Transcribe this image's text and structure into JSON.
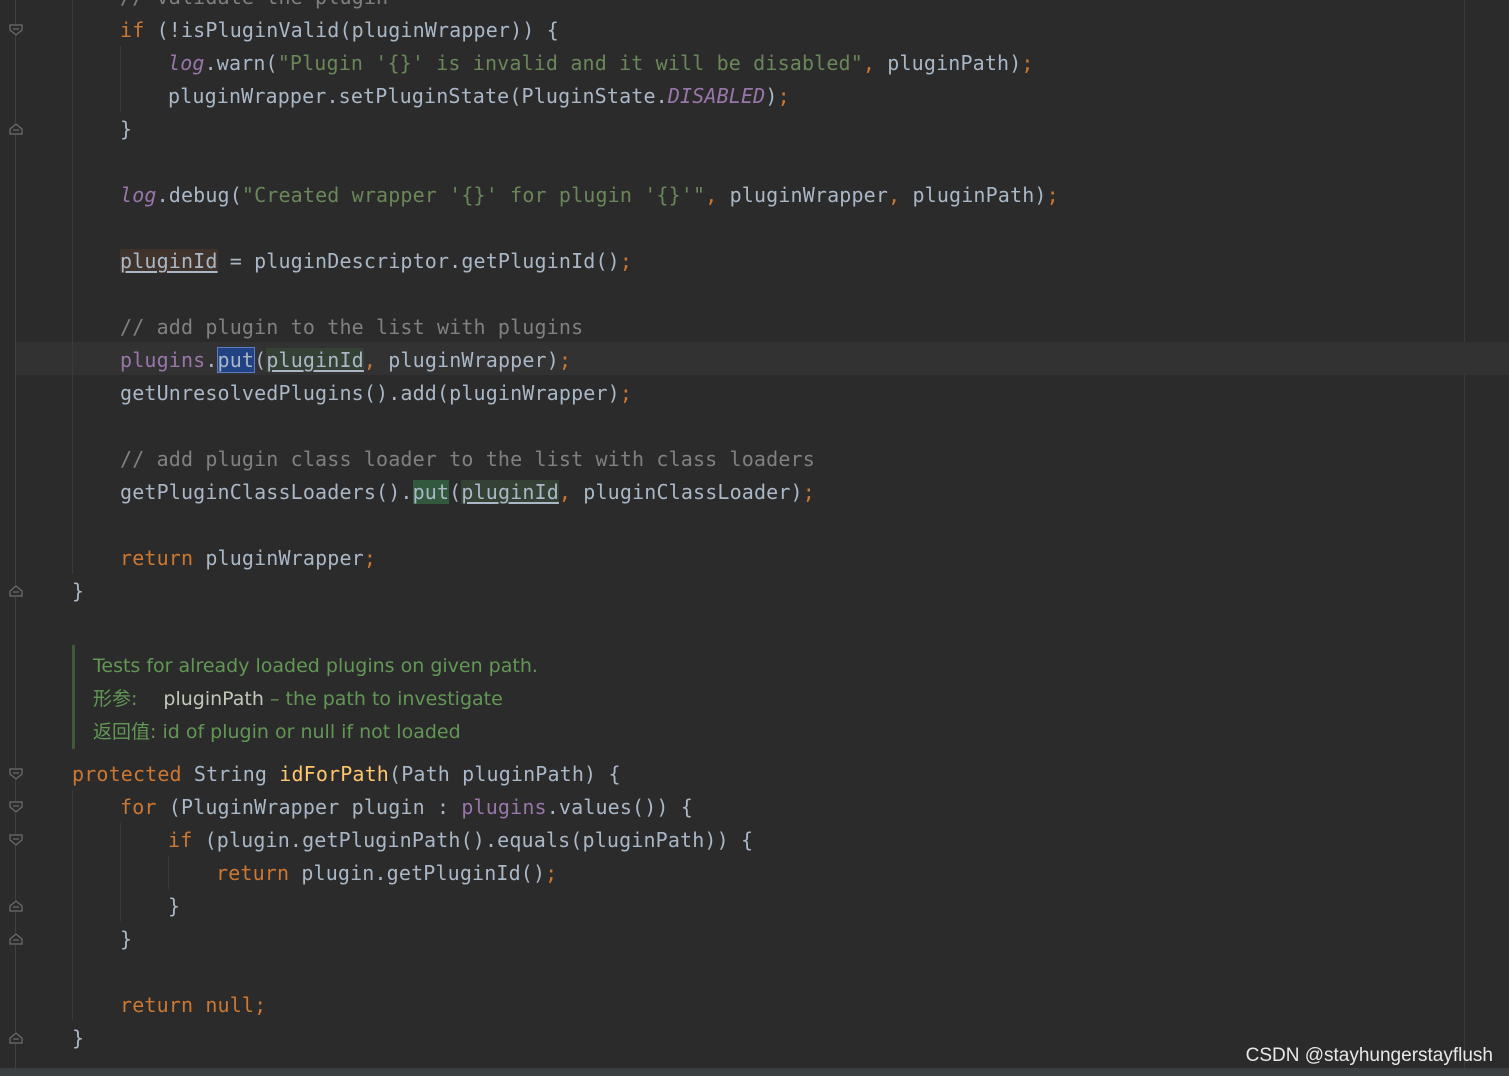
{
  "code": {
    "line_top": "// validate the plugin",
    "if_valid": {
      "kw": "if",
      "rest": " (!isPluginValid(pluginWrapper)) {"
    },
    "warn": {
      "obj": "log",
      "call": ".warn(",
      "str": "\"Plugin '{}' is invalid and it will be disabled\"",
      "comma": ",",
      "args": " pluginPath)",
      "semi": ";"
    },
    "set_state": {
      "pre": "pluginWrapper.setPluginState(PluginState.",
      "const": "DISABLED",
      "post": ")",
      "semi": ";"
    },
    "brace_close": "}",
    "debug": {
      "obj": "log",
      "call": ".debug(",
      "str": "\"Created wrapper '{}' for plugin '{}'\"",
      "c1": ",",
      "a1": " pluginWrapper",
      "c2": ",",
      "a2": " pluginPath)",
      "semi": ";"
    },
    "assign": {
      "var": "pluginId",
      "rest": " = pluginDescriptor.getPluginId()",
      "semi": ";"
    },
    "comment_add": "// add plugin to the list with plugins",
    "put": {
      "obj": "plugins",
      "dot": ".",
      "method": "put",
      "open": "(",
      "arg": "pluginId",
      "comma": ",",
      "rest": " pluginWrapper)",
      "semi": ";"
    },
    "unresolved": {
      "text": "getUnresolvedPlugins().add(pluginWrapper)",
      "semi": ";"
    },
    "comment_loader": "// add plugin class loader to the list with class loaders",
    "loader_put": {
      "pre": "getPluginClassLoaders().",
      "method": "put",
      "open": "(",
      "arg": "pluginId",
      "comma": ",",
      "rest": " pluginClassLoader)",
      "semi": ";"
    },
    "return1": {
      "kw": "return",
      "rest": " pluginWrapper",
      "semi": ";"
    },
    "doc": {
      "summary": "Tests for already loaded plugins on given path.",
      "param_label": "形参:",
      "param_name": "pluginPath",
      "param_desc": " – the path to investigate",
      "return_label": "返回值:",
      "return_desc": " id of plugin or null if not loaded"
    },
    "method_sig": {
      "kw": "protected",
      "type": " String ",
      "name": "idForPath",
      "params": "(Path pluginPath) {"
    },
    "for_line": {
      "kw": "for",
      "pre": " (PluginWrapper plugin : ",
      "fld": "plugins",
      "post": ".values()) {"
    },
    "if_path": {
      "kw": "if",
      "rest": " (plugin.getPluginPath().equals(pluginPath)) {"
    },
    "return2": {
      "kw": "return",
      "rest": " plugin.getPluginId()",
      "semi": ";"
    },
    "return_null": {
      "kw": "return",
      "rest": " null",
      "semi": ";"
    }
  },
  "watermark": "CSDN @stayhungerstayflush",
  "colors": {
    "background": "#2b2b2b",
    "keyword": "#cc7832",
    "string": "#6a8759",
    "comment": "#808080",
    "method": "#ffc66d",
    "field": "#9876aa",
    "plain": "#a9b7c6",
    "javadoc": "#629755"
  }
}
